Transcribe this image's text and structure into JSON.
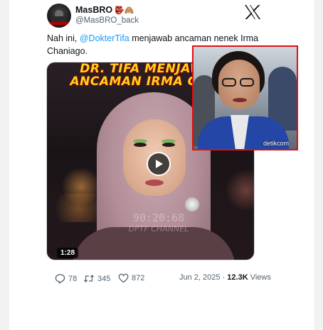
{
  "tweet": {
    "author_name": "MasBRO",
    "author_emojis": "👺🙈",
    "handle": "@MasBRO_back",
    "text_before": "Nah ini, ",
    "mention": "@DokterTifa",
    "text_after": " menjawab ancaman nenek Irma Chaniago."
  },
  "media": {
    "overlay_line1": "DR. TIFA MENJAWAB",
    "overlay_line2": "ANCAMAN IRMA CHANI",
    "watermark_line1": "90:20:68",
    "watermark_line2": "DPTF CHANNEL",
    "duration": "1:28"
  },
  "inset": {
    "logo_text": "detikcom"
  },
  "actions": {
    "replies": "78",
    "retweets": "345",
    "likes": "872",
    "date": "Jun 2, 2025",
    "separator": "·",
    "views_count": "12.3K",
    "views_label": "Views"
  },
  "colors": {
    "accent": "#1d9bf0",
    "text": "#0f1419",
    "muted": "#536471",
    "inset_border": "#e01010"
  },
  "icons": {
    "logo": "x-logo-icon",
    "reply": "reply-icon",
    "retweet": "retweet-icon",
    "like": "heart-icon",
    "play": "play-icon"
  }
}
